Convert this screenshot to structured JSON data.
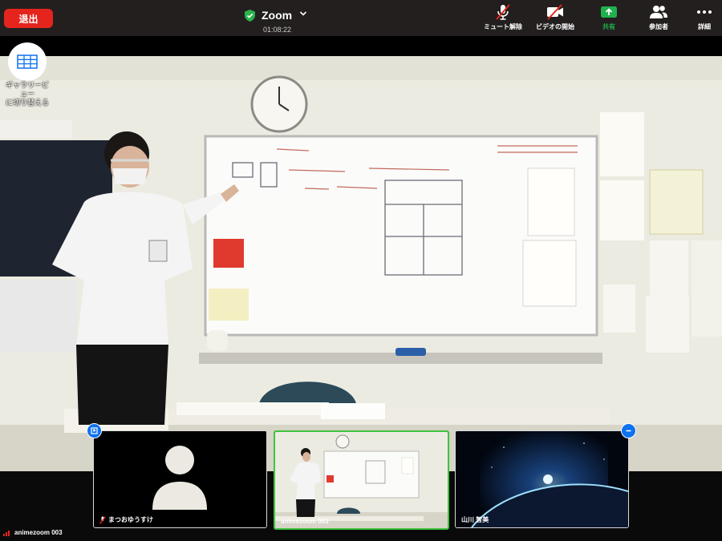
{
  "topbar": {
    "leave_label": "退出",
    "app_title": "Zoom",
    "timer": "01:08:22",
    "tools": [
      {
        "id": "mute",
        "label": "ミュート解除"
      },
      {
        "id": "video",
        "label": "ビデオの開始"
      },
      {
        "id": "share",
        "label": "共有"
      },
      {
        "id": "participants",
        "label": "参加者"
      },
      {
        "id": "more",
        "label": "詳細"
      }
    ]
  },
  "gallery": {
    "label_line1": "ギャラリービ",
    "label_line2": "ュー",
    "label_line3": "に切り替える"
  },
  "thumbnails": [
    {
      "name": "まつおゆうすけ",
      "muted": true
    },
    {
      "name": "animezoom 003",
      "muted": false
    },
    {
      "name": "山川 智美",
      "muted": false
    }
  ],
  "self_view": {
    "name": "animezoom 003"
  },
  "colors": {
    "leave": "#e5251d",
    "share": "#1fb14d",
    "accent": "#0e72ed",
    "active_border": "#3ec43e",
    "topbar": "#231f1f"
  }
}
